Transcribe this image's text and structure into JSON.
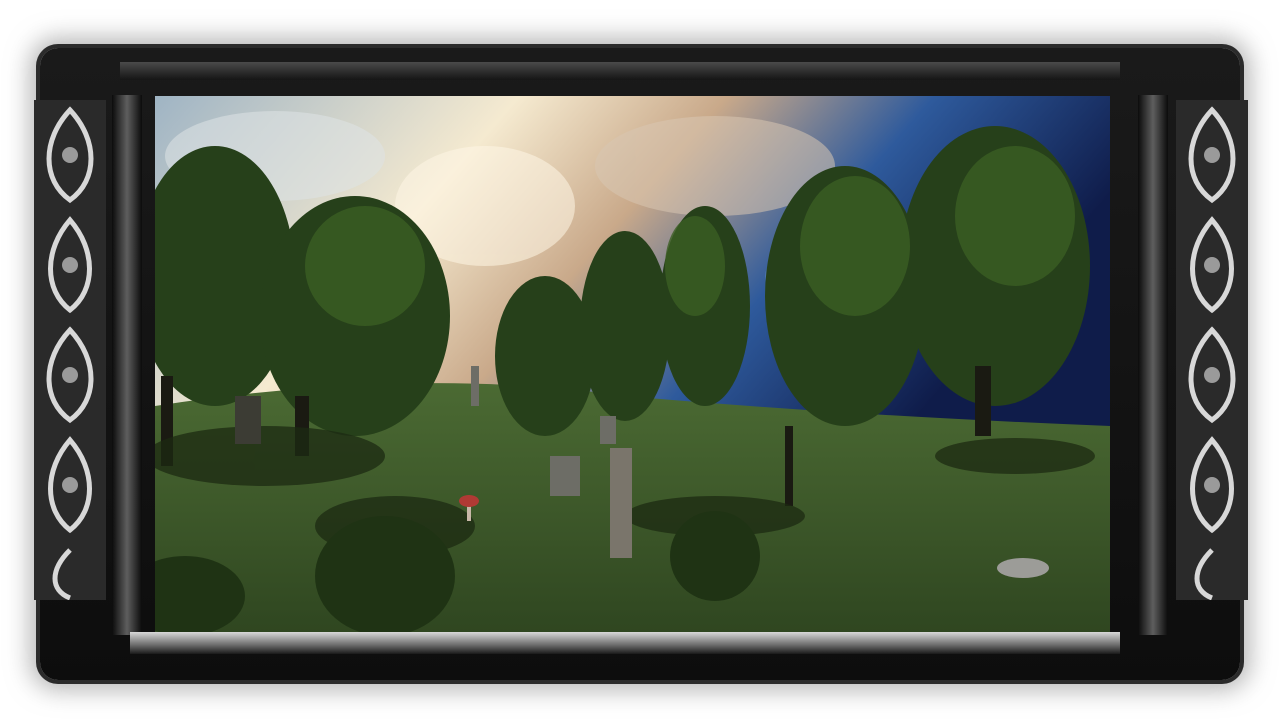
{
  "scene": {
    "sky_colors": [
      "#f5ead0",
      "#c9a98a",
      "#2e5a9c",
      "#0f1c4a"
    ],
    "grass_color": "#3f5a2c",
    "foliage_color": "#2d4a1c",
    "frame_style": "ornate-silver-picture-frame"
  }
}
